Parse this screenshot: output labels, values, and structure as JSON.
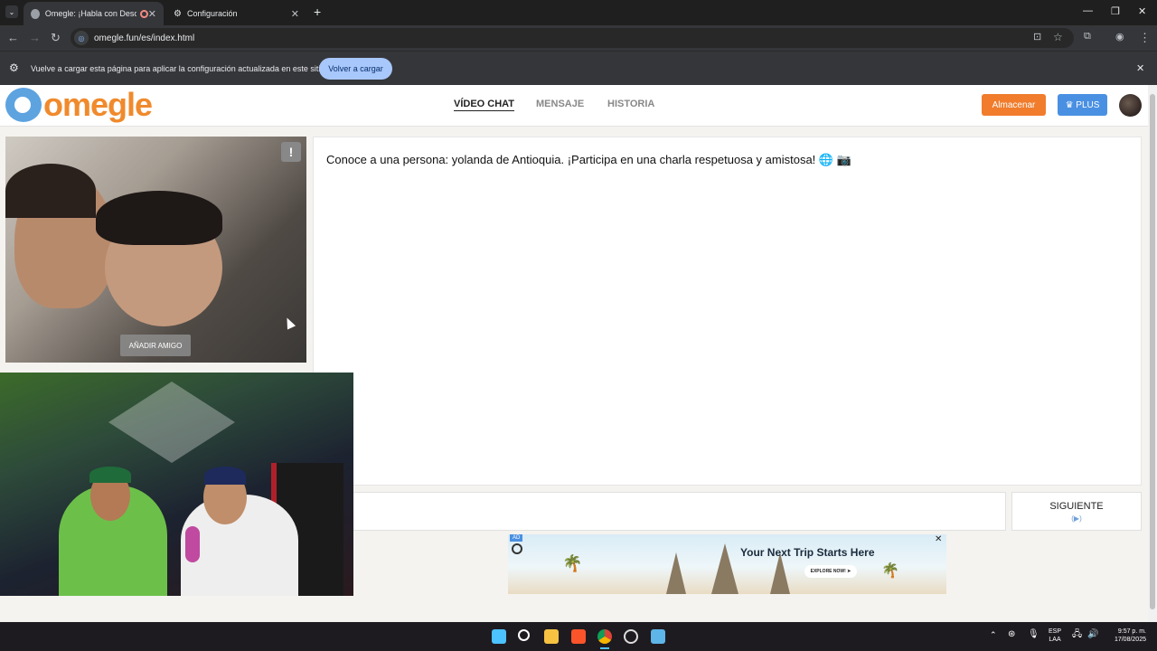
{
  "browser": {
    "tabs": [
      {
        "label": "Omegle: ¡Habla con Descon",
        "active": true
      },
      {
        "label": "Configuración",
        "active": false
      }
    ],
    "new_tab": "+",
    "address": "omegle.fun/es/index.html",
    "infobar": {
      "message": "Vuelve a cargar esta página para aplicar la configuración actualizada en este sitio",
      "button": "Volver a cargar"
    }
  },
  "site": {
    "logo_text": "omegle",
    "nav": [
      {
        "label": "VÍDEO CHAT",
        "active": true
      },
      {
        "label": "MENSAJE",
        "active": false
      },
      {
        "label": "HISTORIA",
        "active": false
      }
    ],
    "store_button": "Almacenar",
    "plus_button": "♛ PLUS"
  },
  "video": {
    "report": "!",
    "add_friend": "AÑADIR AMIGO"
  },
  "chat": {
    "message": "Conoce a una persona: yolanda de Antioquia. ¡Participa en una charla respetuosa y amistosa! 🌐 📷",
    "next_label": "SIGUIENTE",
    "next_icon": "(▶)"
  },
  "ad": {
    "tag": "AD",
    "headline": "Your Next Trip Starts Here",
    "cta": "EXPLORE NOW! ➤",
    "close": "✕"
  },
  "taskbar": {
    "lang_top": "ESP",
    "lang_bottom": "LAA",
    "time": "9:57 p. m.",
    "date": "17/08/2025"
  },
  "colors": {
    "orange": "#f08a2c",
    "blue": "#4a90e2",
    "reload_button": "#a8c7fa"
  }
}
